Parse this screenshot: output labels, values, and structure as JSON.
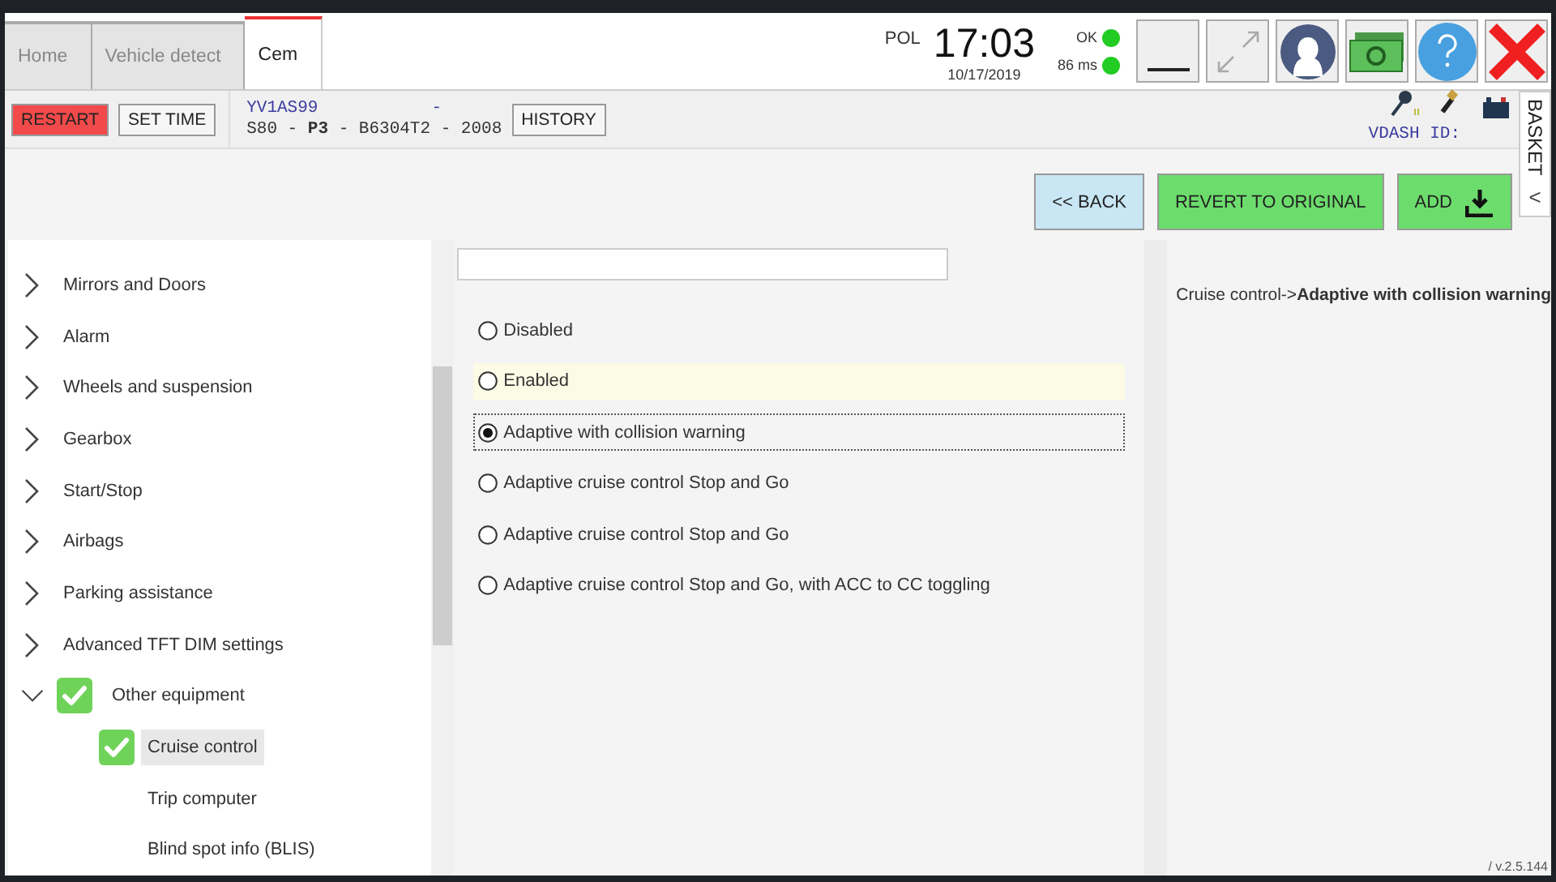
{
  "tabs": [
    {
      "label": "Home",
      "selected": false
    },
    {
      "label": "Vehicle detect",
      "selected": false
    },
    {
      "label": "Cem",
      "selected": true
    }
  ],
  "header": {
    "region": "POL",
    "time": "17:03",
    "date": "10/17/2019",
    "status": [
      {
        "label": "OK",
        "color": "#22cc22"
      },
      {
        "label": "86 ms",
        "color": "#22cc22"
      }
    ]
  },
  "toolbar": {
    "buttons": [
      {
        "label": "RESTART",
        "kind": "danger"
      },
      {
        "label": "SET TIME",
        "kind": "plain"
      }
    ],
    "vin": "YV1AS99",
    "vin_suffix": "-",
    "vehicle": "S80 - **P3** - B6304T2 - 2008",
    "history_button": "HISTORY",
    "vdash_label": "VDASH ID:"
  },
  "basket": {
    "label": "BASKET",
    "arrow": "<"
  },
  "actions": [
    {
      "label": "<< BACK",
      "kind": "back"
    },
    {
      "label": "REVERT TO ORIGINAL",
      "kind": "green"
    },
    {
      "label": "ADD",
      "kind": "add"
    }
  ],
  "tree": [
    {
      "label": "Mirrors and Doors",
      "expanded": false,
      "checked": false,
      "selected": false
    },
    {
      "label": "Alarm",
      "expanded": false,
      "checked": false,
      "selected": false
    },
    {
      "label": "Wheels and suspension",
      "expanded": false,
      "checked": false,
      "selected": false
    },
    {
      "label": "Gearbox",
      "expanded": false,
      "checked": false,
      "selected": false
    },
    {
      "label": "Start/Stop",
      "expanded": false,
      "checked": false,
      "selected": false
    },
    {
      "label": "Airbags",
      "expanded": false,
      "checked": false,
      "selected": false
    },
    {
      "label": "Parking assistance",
      "expanded": false,
      "checked": false,
      "selected": false
    },
    {
      "label": "Advanced TFT DIM settings",
      "expanded": false,
      "checked": false,
      "selected": false
    },
    {
      "label": "Other equipment",
      "expanded": true,
      "checked": true,
      "selected": false,
      "children": [
        {
          "label": "Cruise control",
          "checked": true,
          "selected": true
        },
        {
          "label": "Trip computer",
          "checked": false,
          "selected": false
        },
        {
          "label": "Blind spot info (BLIS)",
          "checked": false,
          "selected": false
        }
      ]
    }
  ],
  "options": [
    {
      "label": "Disabled",
      "selected": false,
      "highlighted": false
    },
    {
      "label": "Enabled",
      "selected": false,
      "highlighted": true
    },
    {
      "label": "Adaptive with collision warning",
      "selected": true,
      "highlighted": false
    },
    {
      "label": "Adaptive cruise control Stop and Go",
      "selected": false,
      "highlighted": false
    },
    {
      "label": "Adaptive cruise control Stop and Go",
      "selected": false,
      "highlighted": false
    },
    {
      "label": "Adaptive cruise control Stop and Go, with ACC to CC toggling",
      "selected": false,
      "highlighted": false
    }
  ],
  "breadcrumb": "Cruise control->**Adaptive with collision warning**",
  "version": "/ v.2.5.144"
}
